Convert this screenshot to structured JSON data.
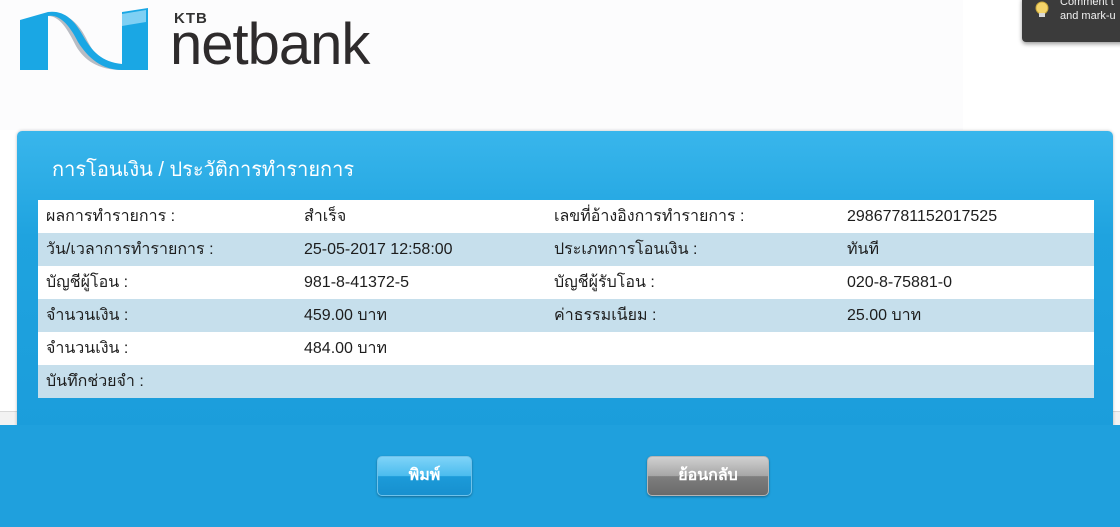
{
  "brand": {
    "prefix": "KTB",
    "name": "netbank",
    "mark_colors": [
      "#1aa7e4",
      "#7fd0f4",
      "#b8bcc3"
    ]
  },
  "hint": {
    "lines": [
      "Comment t",
      "and mark-u"
    ]
  },
  "panel": {
    "title": "การโอนเงิน / ประวัติการทำรายการ",
    "accent": "#1fa3df"
  },
  "rows": [
    {
      "l1": "ผลการทำรายการ  :",
      "v1": "สำเร็จ",
      "l2": "เลขที่อ้างอิงการทำรายการ  :",
      "v2": "29867781152017525"
    },
    {
      "l1": "วัน/เวลาการทำรายการ  :",
      "v1": "25-05-2017 12:58:00",
      "l2": "ประเภทการโอนเงิน  :",
      "v2": "ทันที"
    },
    {
      "l1": "บัญชีผู้โอน  :",
      "v1": "981-8-41372-5",
      "l2": "บัญชีผู้รับโอน  :",
      "v2": "020-8-75881-0"
    },
    {
      "l1": "จำนวนเงิน  :",
      "v1": "459.00 บาท",
      "l2": "ค่าธรรมเนียม  :",
      "v2": "25.00 บาท"
    },
    {
      "l1": "จำนวนเงิน  :",
      "v1": "484.00 บาท",
      "l2": "",
      "v2": ""
    },
    {
      "l1": "บันทึกช่วยจำ  :",
      "v1": "",
      "l2": "",
      "v2": ""
    }
  ],
  "buttons": {
    "print": "พิมพ์",
    "back": "ย้อนกลับ"
  }
}
